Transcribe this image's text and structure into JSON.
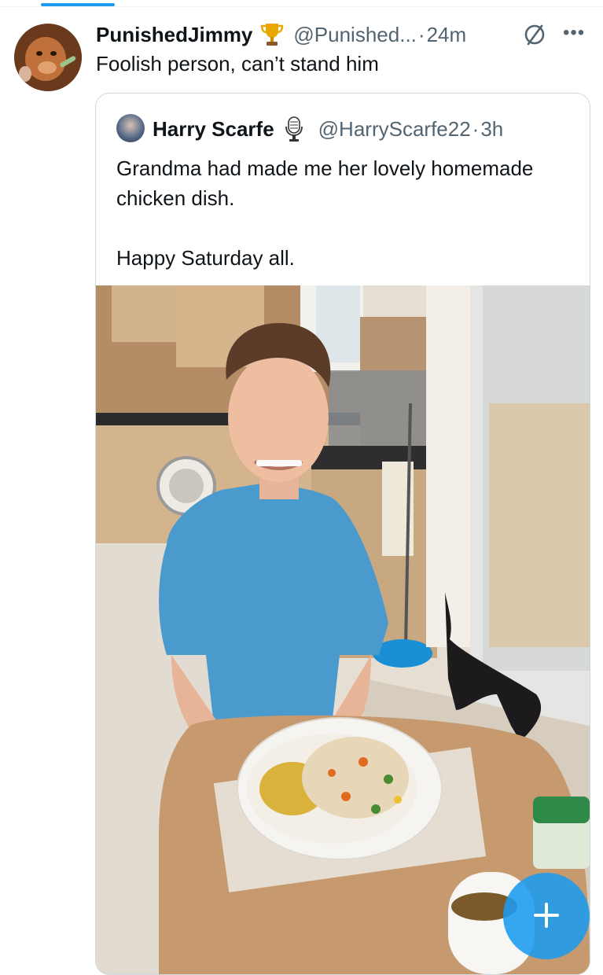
{
  "tweet": {
    "display_name": "PunishedJimmy",
    "handle": "@Punished...",
    "separator": "·",
    "time": "24m",
    "text": "Foolish person, can’t stand him",
    "badge_icon": "trophy-icon",
    "action_icon": "grok-icon",
    "more_icon": "more-icon"
  },
  "quote": {
    "display_name": "Harry Scarfe",
    "handle": "@HarryScarfe22",
    "separator": "·",
    "time": "3h",
    "badge_icon": "microphone-icon",
    "text_lines": [
      "Grandma had made me her lovely homemade chicken dish.",
      "Happy Saturday all."
    ],
    "media": "photo"
  },
  "fab": {
    "icon": "plus-icon"
  },
  "colors": {
    "accent": "#1d9bf0",
    "text": "#0f1419",
    "secondary": "#536471",
    "border": "#cfd9de"
  }
}
